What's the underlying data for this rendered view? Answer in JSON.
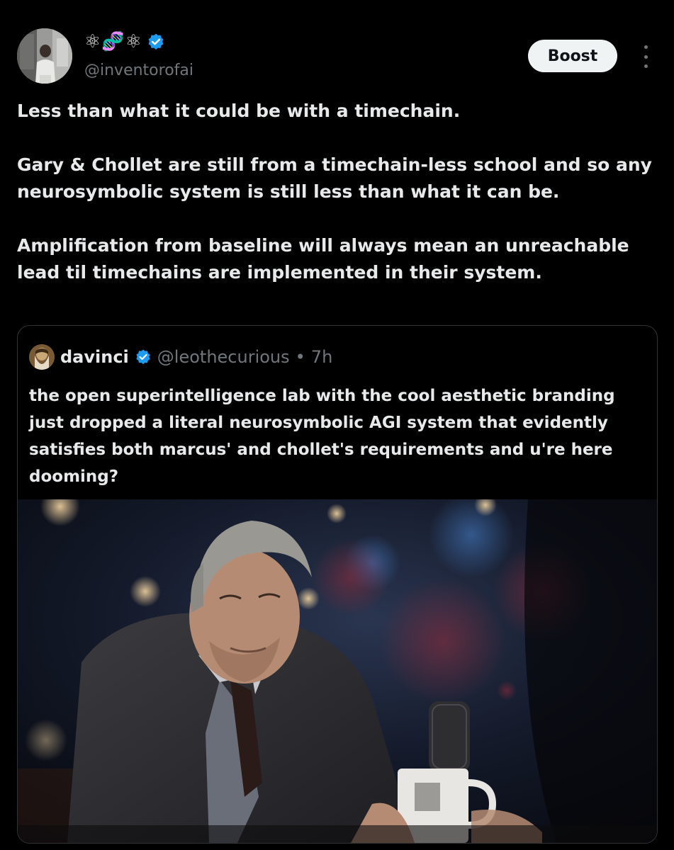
{
  "post": {
    "author": {
      "display_name": "⚛︎🧬⚛︎",
      "handle": "@inventorofai",
      "verified": true,
      "avatar_icon": "person-photo-avatar"
    },
    "boost_label": "Boost",
    "more_icon": "more-vertical-icon",
    "paragraphs": [
      "Less than what it could be with a timechain.",
      "Gary & Chollet are still from a timechain-less school and so any neurosymbolic system is still less than what it can be.",
      "Amplification from baseline will always mean an unreachable lead til timechains are implemented in their system."
    ]
  },
  "quote": {
    "display_name": "davinci",
    "verified": true,
    "handle": "@leothecurious",
    "separator": "•",
    "time": "7h",
    "avatar_icon": "painting-portrait-avatar",
    "text": "the open superintelligence lab with the cool aesthetic branding just dropped a literal neurosymbolic AGI system that evidently satisfies both marcus' and chollet's requirements and u're here dooming?",
    "media_icon": "photo-older-man-at-microphone"
  },
  "colors": {
    "background": "#000000",
    "text_primary": "#e7e9ea",
    "text_secondary": "#71767b",
    "verified_blue": "#1d9bf0",
    "boost_bg": "#eff3f4",
    "border": "#2f3336"
  }
}
